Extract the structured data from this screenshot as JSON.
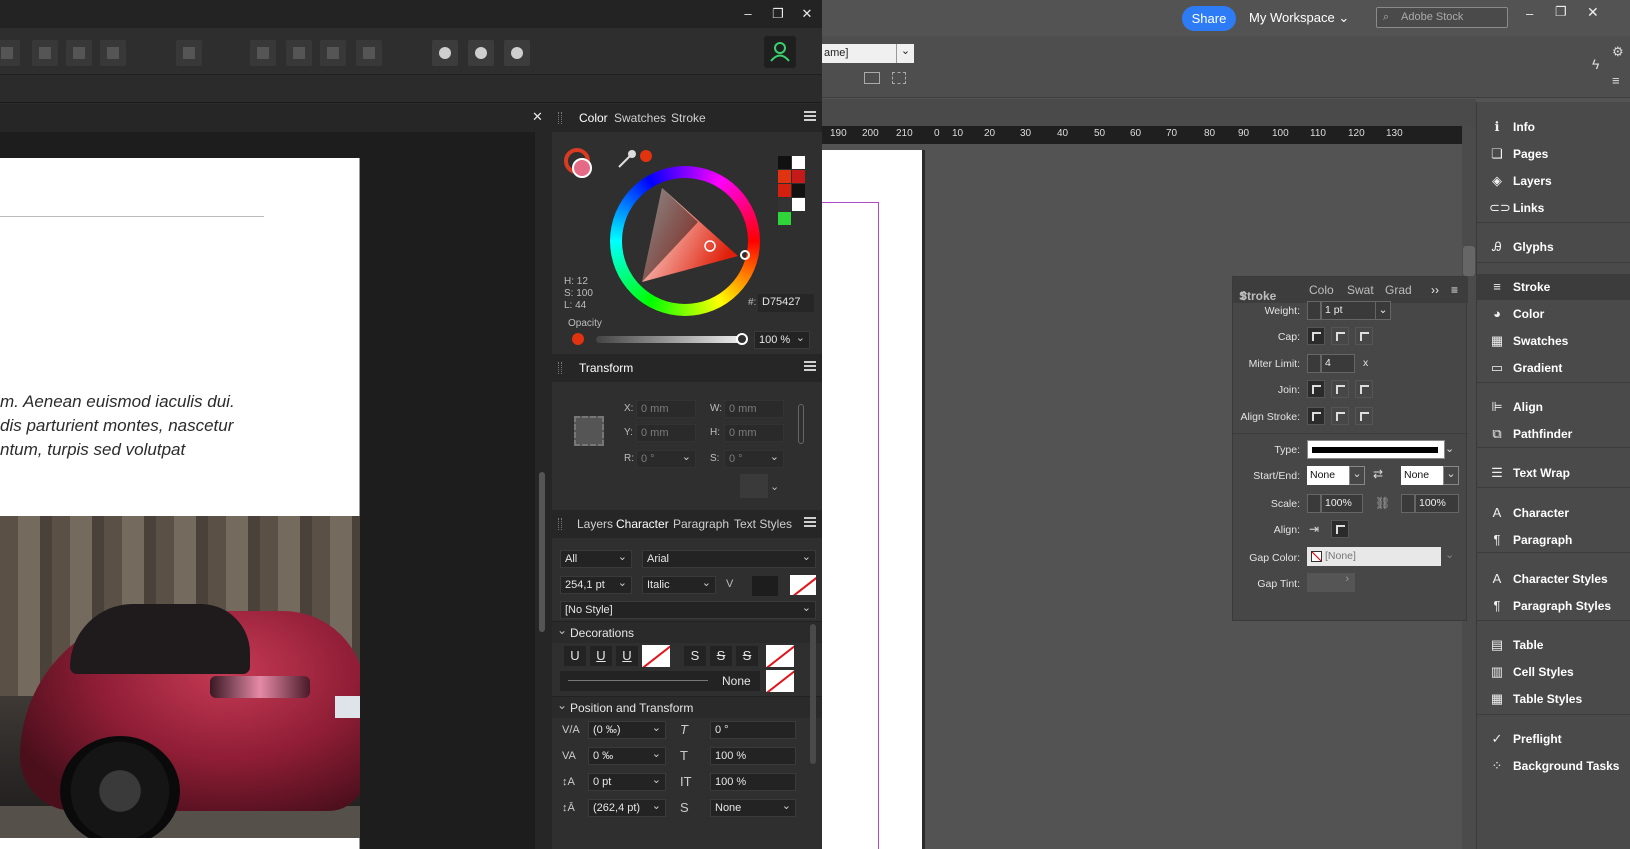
{
  "affinity": {
    "window_controls": {
      "minimize": "–",
      "restore": "❐",
      "close": "✕"
    },
    "doc_close": "✕",
    "body_lines": [
      "m. Aenean euismod iaculis dui.",
      "dis parturient montes, nascetur",
      "ntum, turpis sed volutpat"
    ],
    "color_panel": {
      "tabs": [
        "Color",
        "Swatches",
        "Stroke"
      ],
      "active_tab": "Color",
      "h": "H: 12",
      "s": "S: 100",
      "l": "L: 44",
      "hex_label": "#:",
      "hex": "D75427",
      "opacity_label": "Opacity",
      "opacity_value": "100 %"
    },
    "transform_panel": {
      "title": "Transform",
      "x_label": "X:",
      "x": "0 mm",
      "y_label": "Y:",
      "y": "0 mm",
      "w_label": "W:",
      "w": "0 mm",
      "h_label": "H:",
      "h": "0 mm",
      "r_label": "R:",
      "r": "0 °",
      "s_label": "S:",
      "s": "0 °"
    },
    "char_panel": {
      "tabs": [
        "Layers",
        "Character",
        "Paragraph",
        "Text Styles"
      ],
      "active_tab": "Character",
      "scope": "All",
      "font": "Arial",
      "size": "254,1 pt",
      "style": "Italic",
      "para_style": "[No Style]",
      "decorations_title": "Decorations",
      "deco_buttons": [
        "U",
        "U",
        "U",
        "S",
        "S",
        "S"
      ],
      "line_style": "None",
      "pos_title": "Position and Transform",
      "tracking": "(0 ‰)",
      "kerning": "0 ‰",
      "baseline": "0 pt",
      "leading": "(262,4 pt)",
      "skew": "0 °",
      "scale_h": "100 %",
      "scale_v": "100 %",
      "sub": "None"
    }
  },
  "indesign": {
    "share": "Share",
    "workspace": "My Workspace",
    "stock_placeholder": "Adobe Stock",
    "window_controls": {
      "minimize": "–",
      "restore": "❐",
      "close": "✕"
    },
    "frame_name": "ame]",
    "ruler_ticks": [
      "190",
      "200",
      "210",
      "0",
      "10",
      "20",
      "30",
      "40",
      "50",
      "60",
      "70",
      "80",
      "90",
      "100",
      "110",
      "120",
      "130"
    ],
    "stroke_panel": {
      "tabs": [
        "Stroke",
        "Colo",
        "Swat",
        "Grad"
      ],
      "weight_label": "Weight:",
      "weight": "1 pt",
      "cap_label": "Cap:",
      "miter_label": "Miter Limit:",
      "miter": "4",
      "miter_unit": "x",
      "join_label": "Join:",
      "align_label": "Align Stroke:",
      "type_label": "Type:",
      "startend_label": "Start/End:",
      "start": "None",
      "end": "None",
      "scale_label": "Scale:",
      "scale1": "100%",
      "scale2": "100%",
      "align2_label": "Align:",
      "gapcolor_label": "Gap Color:",
      "gapcolor": "[None]",
      "gaptint_label": "Gap Tint:"
    },
    "dock": [
      {
        "icon": "ℹ",
        "name": "Info"
      },
      {
        "icon": "❏",
        "name": "Pages"
      },
      {
        "icon": "◈",
        "name": "Layers"
      },
      {
        "icon": "⊂⊃",
        "name": "Links"
      },
      {
        "icon": "Ꭿ",
        "name": "Glyphs"
      },
      {
        "icon": "≡",
        "name": "Stroke"
      },
      {
        "icon": "◕",
        "name": "Color"
      },
      {
        "icon": "▦",
        "name": "Swatches"
      },
      {
        "icon": "▭",
        "name": "Gradient"
      },
      {
        "icon": "⊫",
        "name": "Align"
      },
      {
        "icon": "⧉",
        "name": "Pathfinder"
      },
      {
        "icon": "☰",
        "name": "Text Wrap"
      },
      {
        "icon": "A",
        "name": "Character"
      },
      {
        "icon": "¶",
        "name": "Paragraph"
      },
      {
        "icon": "A",
        "name": "Character Styles"
      },
      {
        "icon": "¶",
        "name": "Paragraph Styles"
      },
      {
        "icon": "▤",
        "name": "Table"
      },
      {
        "icon": "▥",
        "name": "Cell Styles"
      },
      {
        "icon": "▦",
        "name": "Table Styles"
      },
      {
        "icon": "✓",
        "name": "Preflight"
      },
      {
        "icon": "⁘",
        "name": "Background Tasks"
      }
    ]
  }
}
